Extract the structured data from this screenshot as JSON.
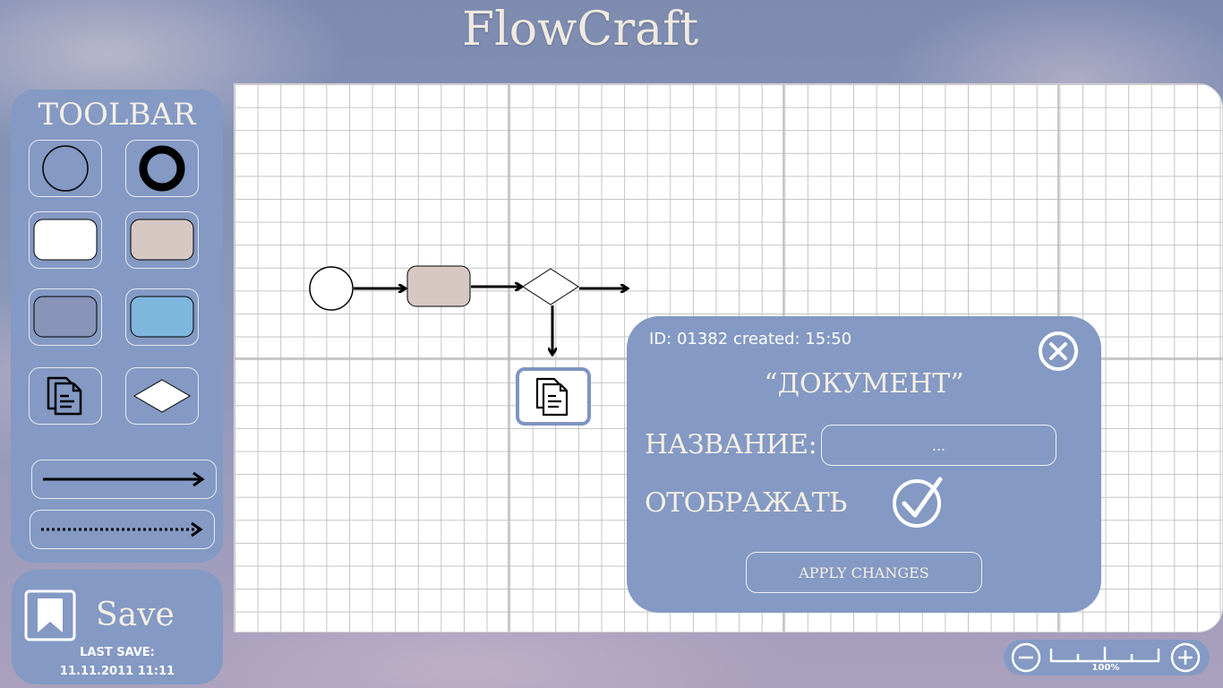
{
  "app": {
    "title": "FlowCraft"
  },
  "toolbar": {
    "title": "TOOLBAR",
    "tools": [
      {
        "name": "start-event-icon"
      },
      {
        "name": "end-event-icon"
      },
      {
        "name": "white-task-icon"
      },
      {
        "name": "beige-task-icon"
      },
      {
        "name": "slate-task-icon"
      },
      {
        "name": "blue-task-icon"
      },
      {
        "name": "document-icon"
      },
      {
        "name": "gateway-diamond-icon"
      },
      {
        "name": "solid-arrow-icon"
      },
      {
        "name": "dotted-arrow-icon"
      }
    ]
  },
  "save": {
    "label": "Save",
    "last_save_label": "LAST SAVE:",
    "last_save_value": "11.11.2011 11:11"
  },
  "dialog": {
    "meta": "ID: 01382 created: 15:50",
    "title": "“ДОКУМЕНТ”",
    "name_label": "НАЗВАНИЕ:",
    "name_value": "...",
    "display_label": "ОТОБРАЖАТЬ",
    "display_checked": true,
    "apply_label": "APPLY CHANGES"
  },
  "zoom": {
    "value": "100%"
  },
  "colors": {
    "panel": "#8499c3",
    "cream": "#f4efe6",
    "task_beige": "#d6c9c4",
    "task_slate": "#8894b8",
    "task_blue": "#7fb6dd",
    "selection": "#7f95c2"
  }
}
